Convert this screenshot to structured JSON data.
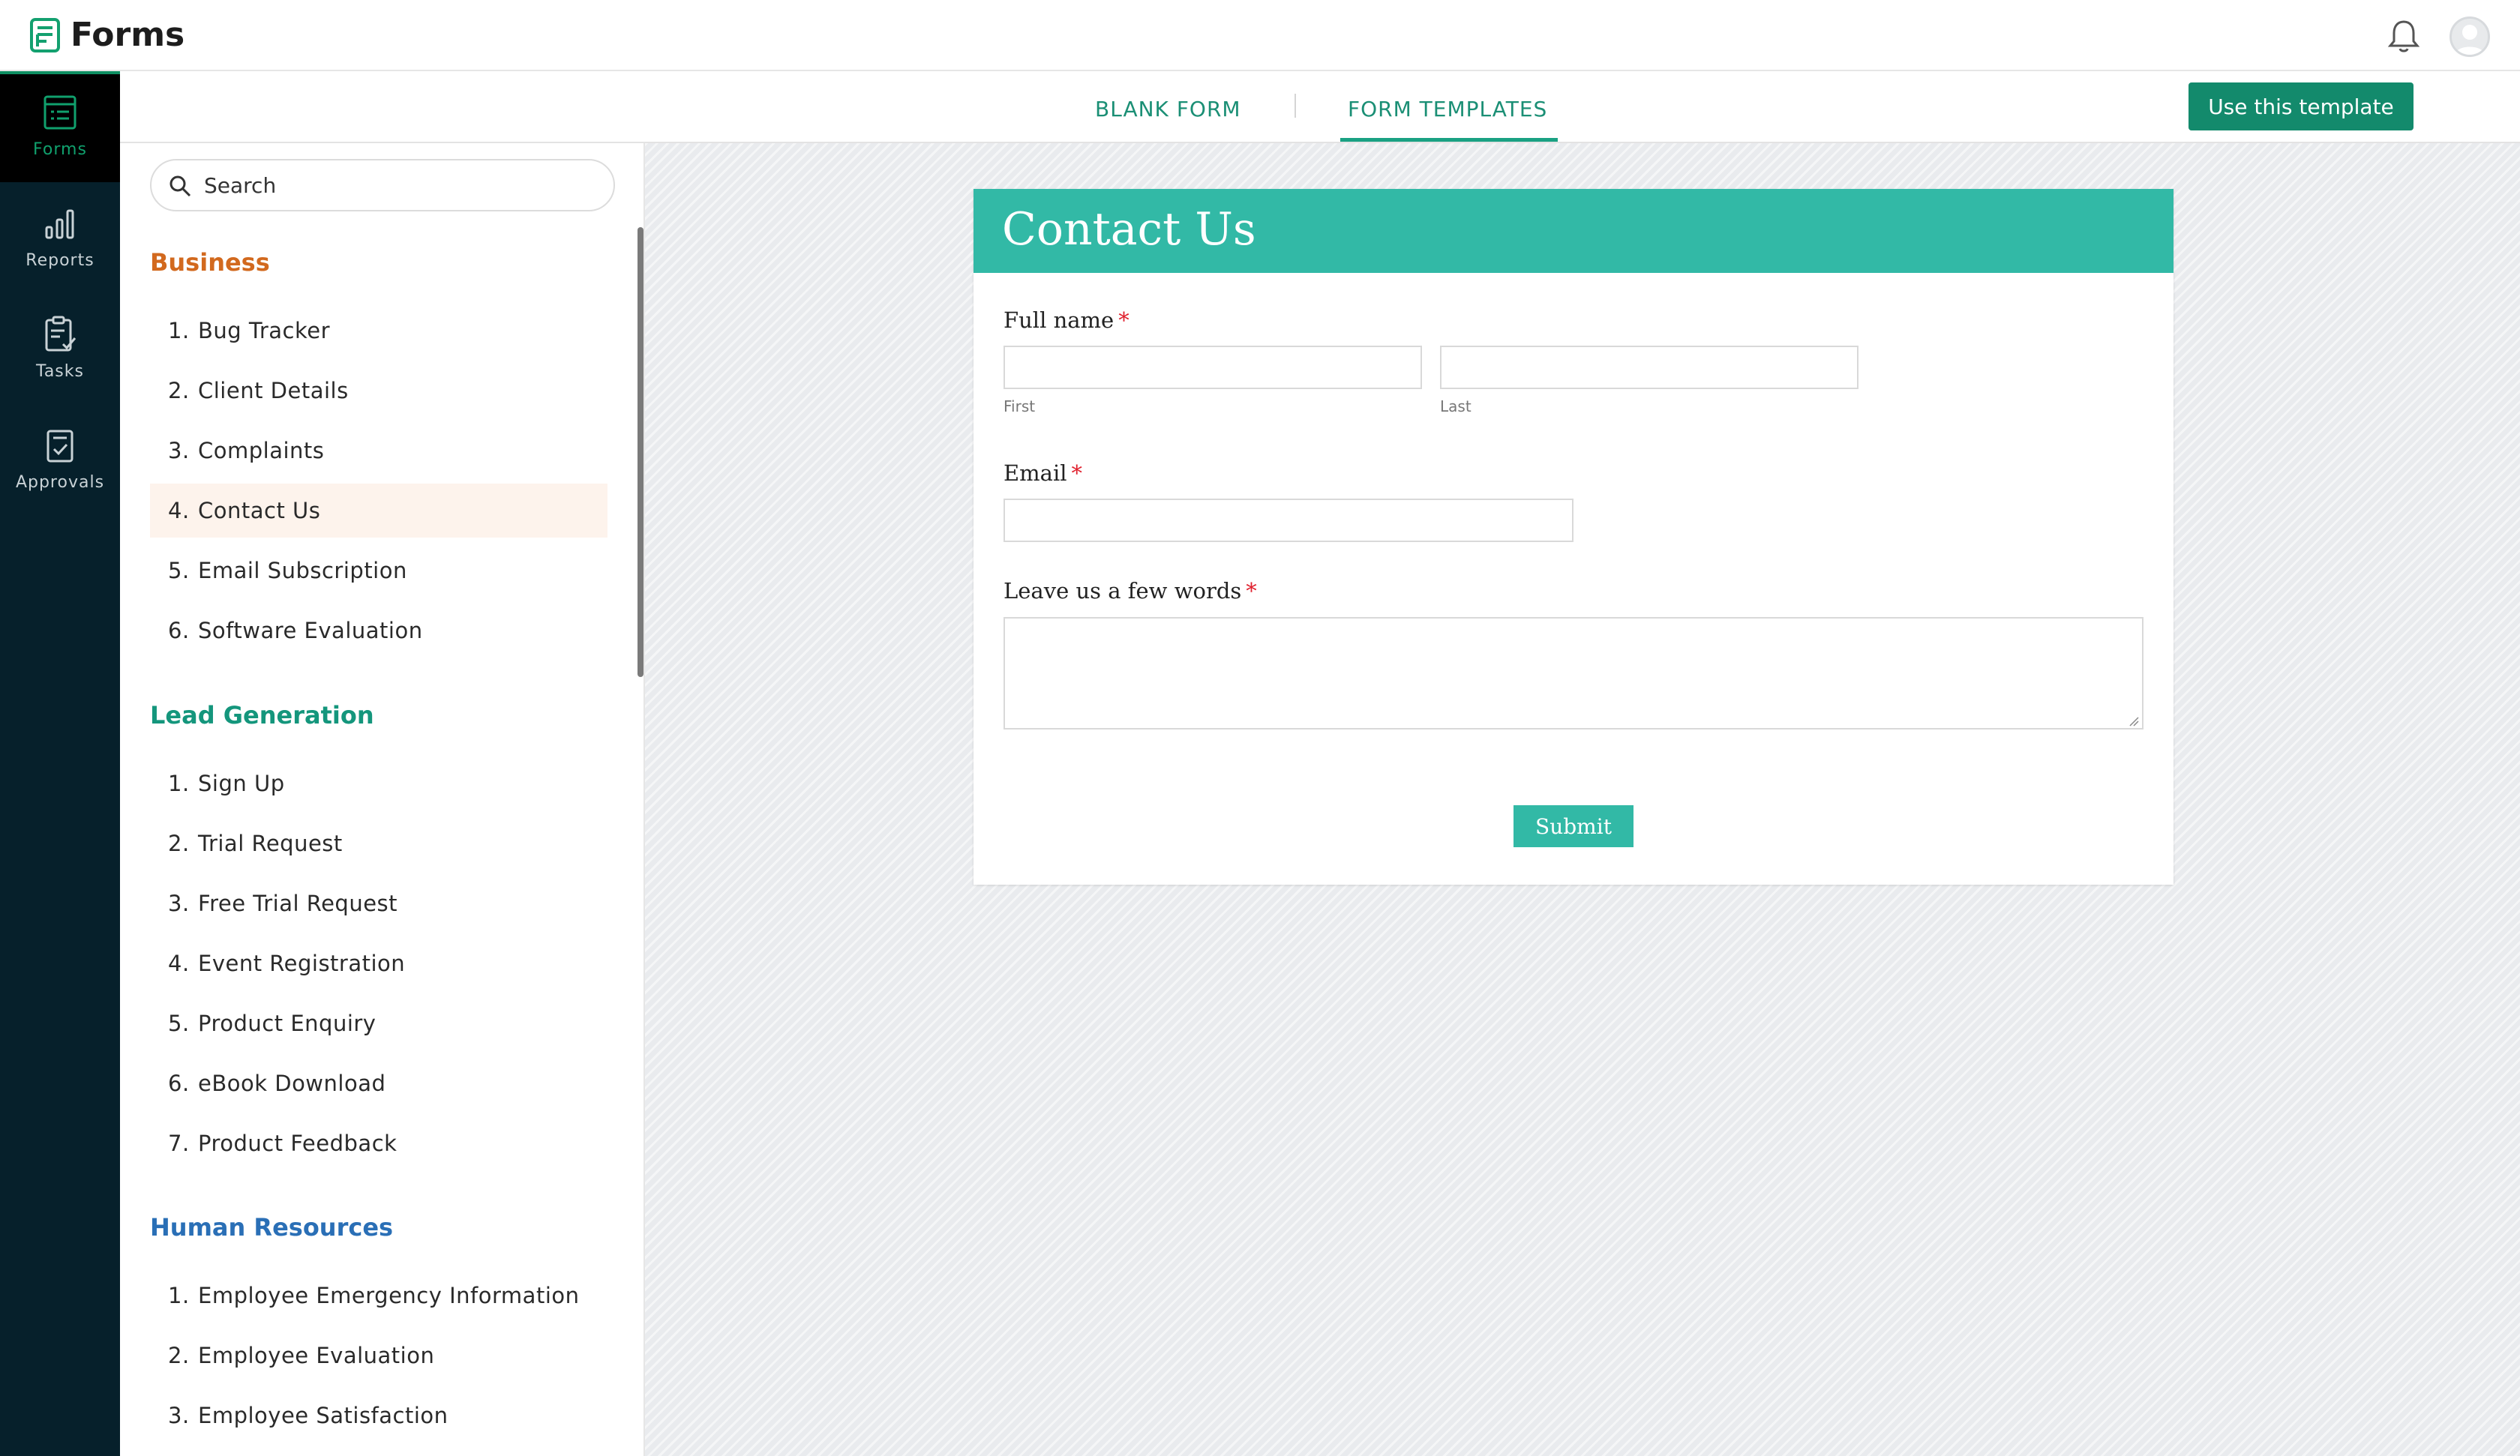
{
  "header": {
    "app_title": "Forms"
  },
  "nav": {
    "items": [
      {
        "label": "Forms",
        "icon": "forms-icon",
        "active": true
      },
      {
        "label": "Reports",
        "icon": "reports-icon",
        "active": false
      },
      {
        "label": "Tasks",
        "icon": "tasks-icon",
        "active": false
      },
      {
        "label": "Approvals",
        "icon": "approvals-icon",
        "active": false
      }
    ]
  },
  "tabs": {
    "blank": "BLANK FORM",
    "templates": "FORM TEMPLATES",
    "active": "templates"
  },
  "actions": {
    "use_template": "Use this template"
  },
  "search": {
    "placeholder": "Search"
  },
  "categories": {
    "business": {
      "title": "Business",
      "items": [
        "Bug Tracker",
        "Client Details",
        "Complaints",
        "Contact Us",
        "Email Subscription",
        "Software Evaluation"
      ]
    },
    "lead": {
      "title": "Lead Generation",
      "items": [
        "Sign Up",
        "Trial Request",
        "Free Trial Request",
        "Event Registration",
        "Product Enquiry",
        "eBook Download",
        "Product Feedback"
      ]
    },
    "hr": {
      "title": "Human Resources",
      "items": [
        "Employee Emergency Information",
        "Employee Evaluation",
        "Employee Satisfaction"
      ]
    }
  },
  "selected_template": "Contact Us",
  "preview": {
    "title": "Contact Us",
    "fields": {
      "full_name": {
        "label": "Full name",
        "required": "*",
        "first": "First",
        "last": "Last"
      },
      "email": {
        "label": "Email",
        "required": "*"
      },
      "message": {
        "label": "Leave us a few words",
        "required": "*"
      }
    },
    "submit": "Submit"
  },
  "colors": {
    "accent": "#138a6c",
    "form_header": "#32b9a6",
    "nav_bg": "#06202b",
    "business": "#d2691e",
    "lead_generation": "#14967c",
    "human_resources": "#2a6fb6",
    "required": "#e0212e"
  }
}
